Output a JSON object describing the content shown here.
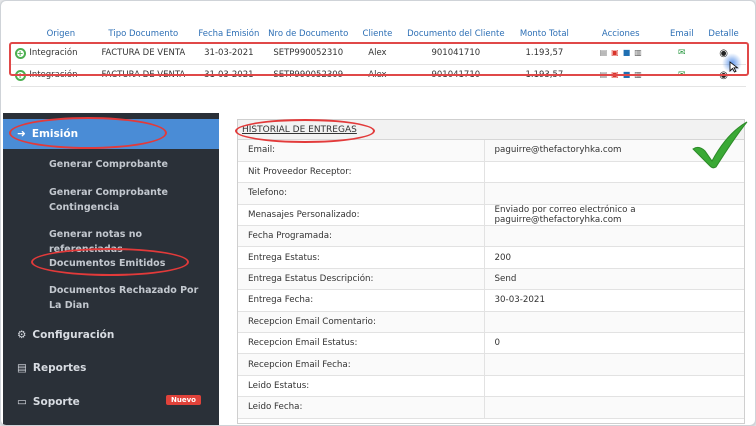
{
  "table": {
    "headers": [
      "Origen",
      "Tipo Documento",
      "Fecha Emisión",
      "Nro de Documento",
      "Cliente",
      "Documento del Cliente",
      "Monto Total",
      "Acciones",
      "Email",
      "Detalle"
    ],
    "rows": [
      {
        "origen": "Integración",
        "tipo": "FACTURA DE VENTA",
        "fecha": "31-03-2021",
        "nro": "SETP990052310",
        "cliente": "Alex",
        "doc_cliente": "901041710",
        "monto": "1.193,57"
      },
      {
        "origen": "Integración",
        "tipo": "FACTURA DE VENTA",
        "fecha": "31-03-2021",
        "nro": "SETP990052309",
        "cliente": "Alex",
        "doc_cliente": "901041710",
        "monto": "1.193,57"
      }
    ]
  },
  "sidebar": {
    "emision": "Emisión",
    "sub_items": [
      "Generar Comprobante",
      "Generar Comprobante Contingencia",
      "Generar notas no referenciadas",
      "Documentos Emitidos",
      "Documentos Rechazado Por La Dian"
    ],
    "configuracion": "Configuración",
    "reportes": "Reportes",
    "soporte": "Soporte",
    "nuevo_badge": "Nuevo"
  },
  "history": {
    "title": "HISTORIAL DE ENTREGAS",
    "fields": [
      {
        "label": "Email:",
        "value": "paguirre@thefactoryhka.com"
      },
      {
        "label": "Nit Proveedor Receptor:",
        "value": ""
      },
      {
        "label": "Telefono:",
        "value": ""
      },
      {
        "label": "Menasajes Personalizado:",
        "value": "Enviado por correo electrónico a paguirre@thefactoryhka.com"
      },
      {
        "label": "Fecha Programada:",
        "value": ""
      },
      {
        "label": "Entrega Estatus:",
        "value": "200"
      },
      {
        "label": "Entrega Estatus Descripción:",
        "value": "Send"
      },
      {
        "label": "Entrega Fecha:",
        "value": "30-03-2021"
      },
      {
        "label": "Recepcion Email Comentario:",
        "value": ""
      },
      {
        "label": "Recepcion Email Estatus:",
        "value": "0"
      },
      {
        "label": "Recepcion Email Fecha:",
        "value": ""
      },
      {
        "label": "Leido Estatus:",
        "value": ""
      },
      {
        "label": "Leido Fecha:",
        "value": ""
      }
    ]
  },
  "colors": {
    "accent": "#4a8cd6",
    "highlight": "#e23a3a",
    "sidebar": "#2a3038",
    "check": "#3aa935"
  }
}
